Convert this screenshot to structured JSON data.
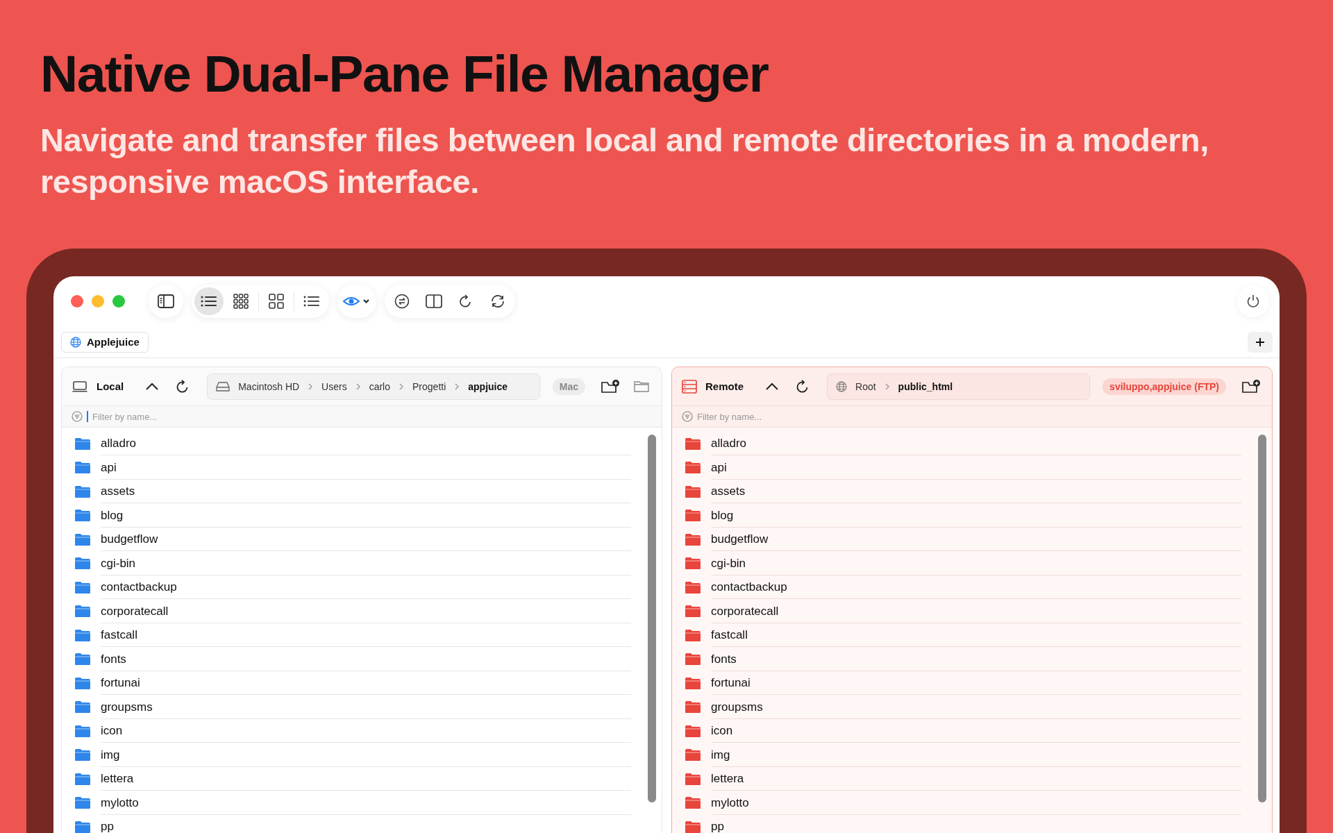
{
  "headline": "Native Dual-Pane File Manager",
  "subtitle": "Navigate and transfer files between local and remote directories in a modern, responsive macOS interface.",
  "view_modes": [
    {
      "kind": "list",
      "selected": true
    },
    {
      "kind": "grid-small",
      "selected": false
    },
    {
      "kind": "grid-large",
      "selected": false
    },
    {
      "kind": "outline",
      "selected": false
    }
  ],
  "tabs": [
    {
      "label": "Applejuice",
      "selected": true
    }
  ],
  "panes": [
    {
      "kind": "local",
      "title": "Local",
      "breadcrumb": [
        "Macintosh HD",
        "Users",
        "carlo",
        "Progetti",
        "appjuice"
      ],
      "badge": "Mac",
      "actions": [
        {
          "kind": "new-folder"
        },
        {
          "kind": "open-folder"
        }
      ],
      "filter": {
        "placeholder": "Filter by name...",
        "focused": true
      },
      "items": [
        "alladro",
        "api",
        "assets",
        "blog",
        "budgetflow",
        "cgi-bin",
        "contactbackup",
        "corporatecall",
        "fastcall",
        "fonts",
        "fortunai",
        "groupsms",
        "icon",
        "img",
        "lettera",
        "mylotto",
        "pp"
      ]
    },
    {
      "kind": "remote",
      "title": "Remote",
      "breadcrumb": [
        "Root",
        "public_html"
      ],
      "badge": "sviluppo,appjuice (FTP)",
      "actions": [
        {
          "kind": "new-folder"
        }
      ],
      "filter": {
        "placeholder": "Filter by name...",
        "focused": false
      },
      "items": [
        "alladro",
        "api",
        "assets",
        "blog",
        "budgetflow",
        "cgi-bin",
        "contactbackup",
        "corporatecall",
        "fastcall",
        "fonts",
        "fortunai",
        "groupsms",
        "icon",
        "img",
        "lettera",
        "mylotto",
        "pp"
      ]
    }
  ]
}
